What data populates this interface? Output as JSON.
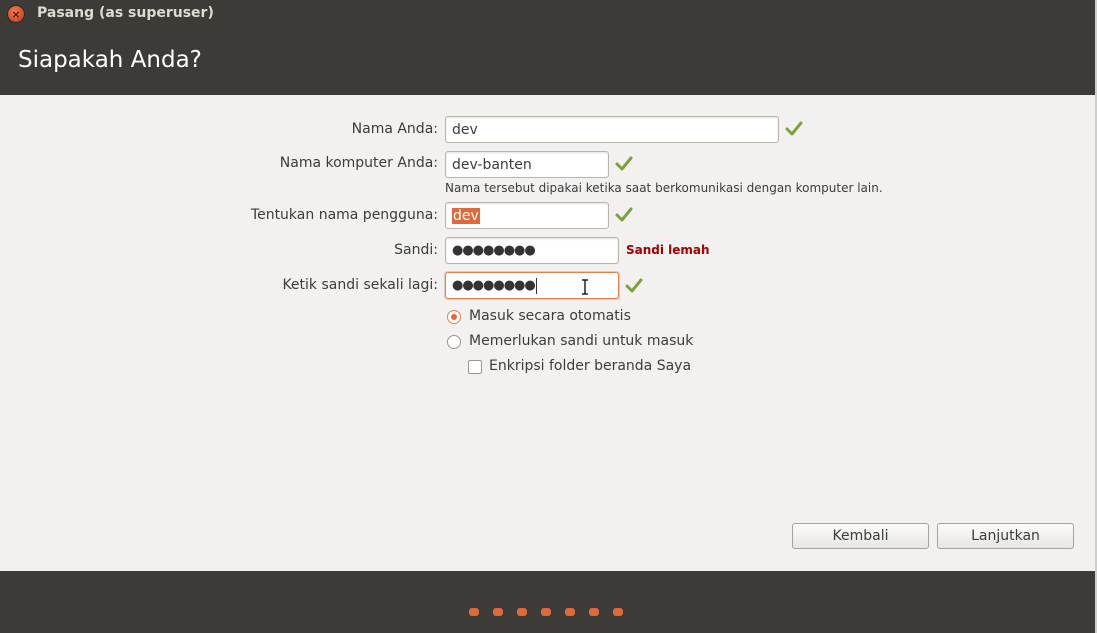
{
  "window": {
    "title": "Pasang (as superuser)",
    "close_icon": "close-icon"
  },
  "header": {
    "title": "Siapakah Anda?"
  },
  "form": {
    "name_label": "Nama Anda:",
    "name_value": "dev",
    "computer_label": "Nama komputer Anda:",
    "computer_value": "dev-banten",
    "computer_hint": "Nama tersebut dipakai ketika saat berkomunikasi dengan komputer lain.",
    "username_label": "Tentukan nama pengguna:",
    "username_value": "dev",
    "password_label": "Sandi:",
    "password_value": "●●●●●●●●",
    "password_strength": "Sandi lemah",
    "confirm_label": "Ketik sandi sekali lagi:",
    "confirm_value": "●●●●●●●●",
    "login_auto_label": "Masuk secara otomatis",
    "login_require_label": "Memerlukan sandi untuk masuk",
    "encrypt_label": "Enkripsi folder beranda Saya",
    "login_mode": "auto",
    "encrypt_checked": false
  },
  "buttons": {
    "back": "Kembali",
    "continue": "Lanjutkan"
  },
  "progress": {
    "steps": 7,
    "accent": "#e0693c"
  },
  "colors": {
    "header_bg": "#3c3b37",
    "body_bg": "#f2f1f0",
    "accent": "#e0693c",
    "check_green": "#7aa33a",
    "warning_red": "#a40000"
  }
}
